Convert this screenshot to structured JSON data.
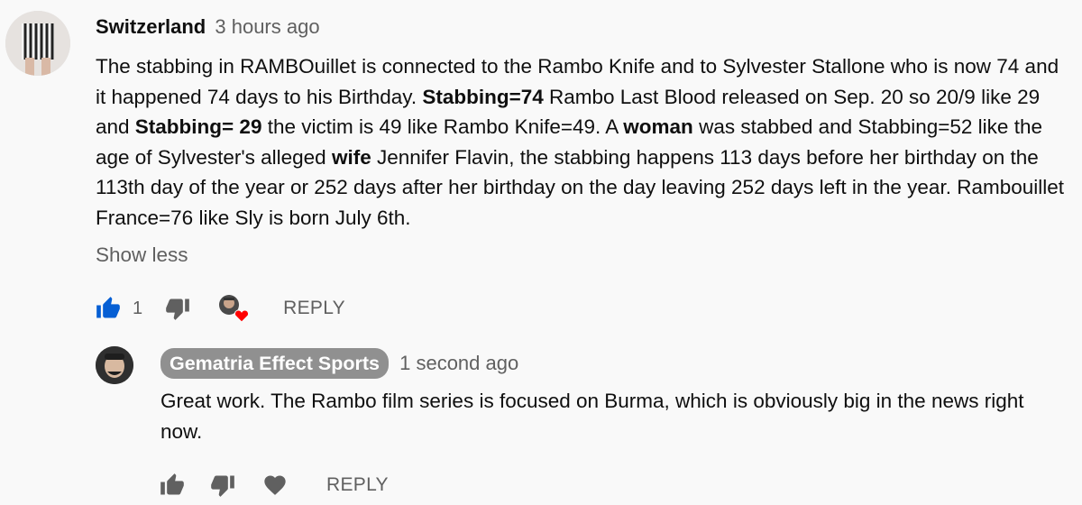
{
  "comment": {
    "author": "Switzerland",
    "time": "3 hours ago",
    "body": [
      {
        "text": "The stabbing in RAMBOuillet is connected to the Rambo Knife and to Sylvester Stallone who is now 74 and it happened 74 days to his Birthday. ",
        "bold": false
      },
      {
        "text": "Stabbing=74",
        "bold": true
      },
      {
        "text": " Rambo Last Blood released on Sep. 20 so 20/9 like 29 and ",
        "bold": false
      },
      {
        "text": "Stabbing= 29",
        "bold": true
      },
      {
        "text": " the victim is 49 like Rambo Knife=49. A ",
        "bold": false
      },
      {
        "text": "woman",
        "bold": true
      },
      {
        "text": " was stabbed and Stabbing=52 like the age of Sylvester's alleged ",
        "bold": false
      },
      {
        "text": "wife",
        "bold": true
      },
      {
        "text": " Jennifer Flavin, the stabbing happens 113 days before her birthday on the 113th day of the year or 252 days after her birthday on the day leaving 252 days left in the year. Rambouillet France=76 like Sly is born July 6th.",
        "bold": false
      }
    ],
    "show_less": "Show less",
    "like_count": "1",
    "reply_label": "REPLY"
  },
  "reply": {
    "author": "Gematria Effect Sports",
    "time": "1 second ago",
    "body": "Great work.  The Rambo film series is focused on Burma, which is obviously big in the news right now.",
    "reply_label": "REPLY"
  },
  "colors": {
    "like_active": "#065fd4",
    "heart": "#ff0000",
    "icon_gray": "#606060",
    "chip_bg": "#909090"
  },
  "icons": {
    "like": "thumbs-up-icon",
    "dislike": "thumbs-down-icon",
    "heart": "heart-icon"
  }
}
